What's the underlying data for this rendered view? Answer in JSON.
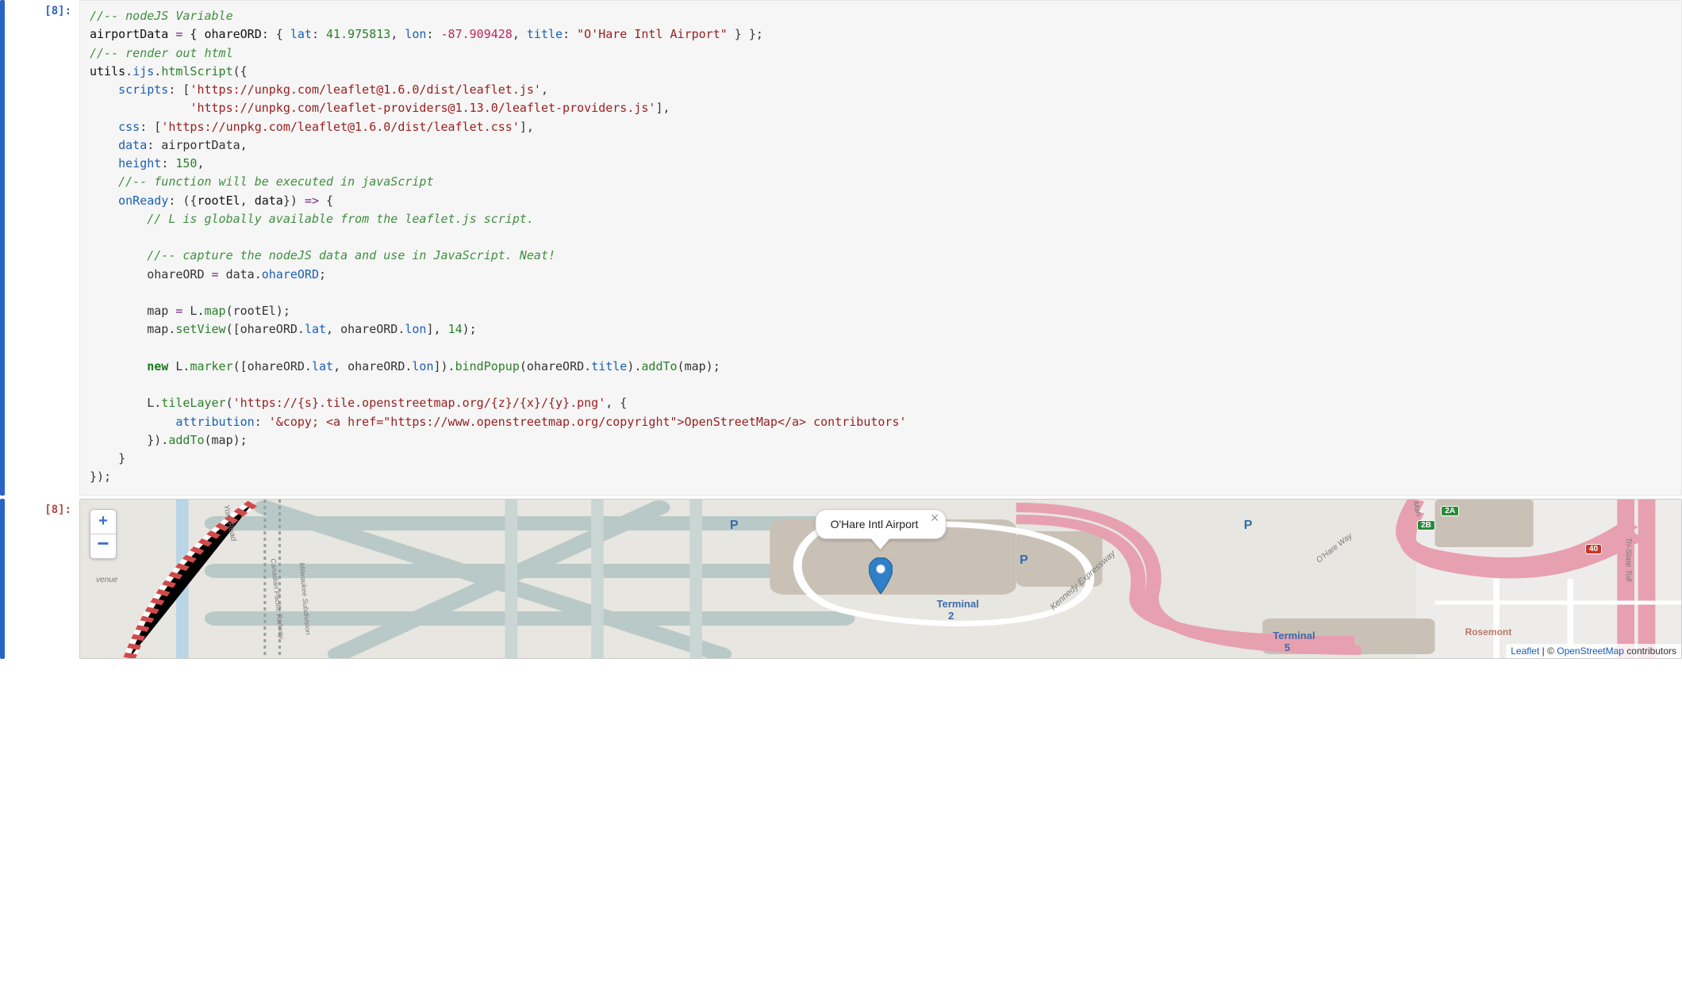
{
  "cells": {
    "code": {
      "prompt": "[8]:",
      "lines": [
        [
          {
            "cls": "c-cmt",
            "t": "//-- nodeJS Variable"
          }
        ],
        [
          {
            "cls": "c-ident",
            "t": "airportData "
          },
          {
            "cls": "c-op",
            "t": "="
          },
          {
            "cls": "c-ident",
            "t": " { ohareORD"
          },
          {
            "cls": "c-punct",
            "t": ": { "
          },
          {
            "cls": "c-prop",
            "t": "lat"
          },
          {
            "cls": "c-punct",
            "t": ": "
          },
          {
            "cls": "c-num",
            "t": "41.975813"
          },
          {
            "cls": "c-punct",
            "t": ", "
          },
          {
            "cls": "c-prop",
            "t": "lon"
          },
          {
            "cls": "c-punct",
            "t": ": "
          },
          {
            "cls": "c-neg",
            "t": "-87.909428"
          },
          {
            "cls": "c-punct",
            "t": ", "
          },
          {
            "cls": "c-prop",
            "t": "title"
          },
          {
            "cls": "c-punct",
            "t": ": "
          },
          {
            "cls": "c-str",
            "t": "\"O'Hare Intl Airport\""
          },
          {
            "cls": "c-punct",
            "t": " } };"
          }
        ],
        [
          {
            "cls": "c-cmt",
            "t": "//-- render out html"
          }
        ],
        [
          {
            "cls": "c-ident",
            "t": "utils"
          },
          {
            "cls": "c-punct",
            "t": "."
          },
          {
            "cls": "c-member",
            "t": "ijs"
          },
          {
            "cls": "c-punct",
            "t": "."
          },
          {
            "cls": "c-call",
            "t": "htmlScript"
          },
          {
            "cls": "c-punct",
            "t": "({"
          }
        ],
        [
          {
            "cls": "c-punct",
            "t": "    "
          },
          {
            "cls": "c-prop",
            "t": "scripts"
          },
          {
            "cls": "c-punct",
            "t": ": ["
          },
          {
            "cls": "c-str",
            "t": "'https://unpkg.com/leaflet@1.6.0/dist/leaflet.js'"
          },
          {
            "cls": "c-punct",
            "t": ","
          }
        ],
        [
          {
            "cls": "c-punct",
            "t": "              "
          },
          {
            "cls": "c-str",
            "t": "'https://unpkg.com/leaflet-providers@1.13.0/leaflet-providers.js'"
          },
          {
            "cls": "c-punct",
            "t": "],"
          }
        ],
        [
          {
            "cls": "c-punct",
            "t": "    "
          },
          {
            "cls": "c-prop",
            "t": "css"
          },
          {
            "cls": "c-punct",
            "t": ": ["
          },
          {
            "cls": "c-str",
            "t": "'https://unpkg.com/leaflet@1.6.0/dist/leaflet.css'"
          },
          {
            "cls": "c-punct",
            "t": "],"
          }
        ],
        [
          {
            "cls": "c-punct",
            "t": "    "
          },
          {
            "cls": "c-prop",
            "t": "data"
          },
          {
            "cls": "c-punct",
            "t": ": airportData,"
          }
        ],
        [
          {
            "cls": "c-punct",
            "t": "    "
          },
          {
            "cls": "c-prop",
            "t": "height"
          },
          {
            "cls": "c-punct",
            "t": ": "
          },
          {
            "cls": "c-num",
            "t": "150"
          },
          {
            "cls": "c-punct",
            "t": ","
          }
        ],
        [
          {
            "cls": "c-punct",
            "t": "    "
          },
          {
            "cls": "c-cmt",
            "t": "//-- function will be executed in javaScript"
          }
        ],
        [
          {
            "cls": "c-punct",
            "t": "    "
          },
          {
            "cls": "c-prop",
            "t": "onReady"
          },
          {
            "cls": "c-punct",
            "t": ": ({"
          },
          {
            "cls": "c-ident",
            "t": "rootEl"
          },
          {
            "cls": "c-punct",
            "t": ", "
          },
          {
            "cls": "c-ident",
            "t": "data"
          },
          {
            "cls": "c-punct",
            "t": "}) "
          },
          {
            "cls": "c-op",
            "t": "=>"
          },
          {
            "cls": "c-punct",
            "t": " {"
          }
        ],
        [
          {
            "cls": "c-punct",
            "t": "        "
          },
          {
            "cls": "c-cmt",
            "t": "// L is globally available from the leaflet.js script."
          }
        ],
        [
          {
            "cls": "c-punct",
            "t": ""
          }
        ],
        [
          {
            "cls": "c-punct",
            "t": "        "
          },
          {
            "cls": "c-cmt",
            "t": "//-- capture the nodeJS data and use in JavaScript. Neat!"
          }
        ],
        [
          {
            "cls": "c-punct",
            "t": "        ohareORD "
          },
          {
            "cls": "c-op",
            "t": "="
          },
          {
            "cls": "c-punct",
            "t": " data."
          },
          {
            "cls": "c-member",
            "t": "ohareORD"
          },
          {
            "cls": "c-punct",
            "t": ";"
          }
        ],
        [
          {
            "cls": "c-punct",
            "t": ""
          }
        ],
        [
          {
            "cls": "c-punct",
            "t": "        map "
          },
          {
            "cls": "c-op",
            "t": "="
          },
          {
            "cls": "c-punct",
            "t": " L."
          },
          {
            "cls": "c-call",
            "t": "map"
          },
          {
            "cls": "c-punct",
            "t": "(rootEl);"
          }
        ],
        [
          {
            "cls": "c-punct",
            "t": "        map."
          },
          {
            "cls": "c-call",
            "t": "setView"
          },
          {
            "cls": "c-punct",
            "t": "([ohareORD."
          },
          {
            "cls": "c-member",
            "t": "lat"
          },
          {
            "cls": "c-punct",
            "t": ", ohareORD."
          },
          {
            "cls": "c-member",
            "t": "lon"
          },
          {
            "cls": "c-punct",
            "t": "], "
          },
          {
            "cls": "c-num",
            "t": "14"
          },
          {
            "cls": "c-punct",
            "t": ");"
          }
        ],
        [
          {
            "cls": "c-punct",
            "t": ""
          }
        ],
        [
          {
            "cls": "c-punct",
            "t": "        "
          },
          {
            "cls": "c-kw",
            "t": "new"
          },
          {
            "cls": "c-punct",
            "t": " L."
          },
          {
            "cls": "c-call",
            "t": "marker"
          },
          {
            "cls": "c-punct",
            "t": "([ohareORD."
          },
          {
            "cls": "c-member",
            "t": "lat"
          },
          {
            "cls": "c-punct",
            "t": ", ohareORD."
          },
          {
            "cls": "c-member",
            "t": "lon"
          },
          {
            "cls": "c-punct",
            "t": "])."
          },
          {
            "cls": "c-call",
            "t": "bindPopup"
          },
          {
            "cls": "c-punct",
            "t": "(ohareORD."
          },
          {
            "cls": "c-member",
            "t": "title"
          },
          {
            "cls": "c-punct",
            "t": ")."
          },
          {
            "cls": "c-call",
            "t": "addTo"
          },
          {
            "cls": "c-punct",
            "t": "(map);"
          }
        ],
        [
          {
            "cls": "c-punct",
            "t": ""
          }
        ],
        [
          {
            "cls": "c-punct",
            "t": "        L."
          },
          {
            "cls": "c-call",
            "t": "tileLayer"
          },
          {
            "cls": "c-punct",
            "t": "("
          },
          {
            "cls": "c-str",
            "t": "'https://{s}.tile.openstreetmap.org/{z}/{x}/{y}.png'"
          },
          {
            "cls": "c-punct",
            "t": ", {"
          }
        ],
        [
          {
            "cls": "c-punct",
            "t": "            "
          },
          {
            "cls": "c-prop",
            "t": "attribution"
          },
          {
            "cls": "c-punct",
            "t": ": "
          },
          {
            "cls": "c-str",
            "t": "'&copy; <a href=\"https://www.openstreetmap.org/copyright\">OpenStreetMap</a> contributors'"
          }
        ],
        [
          {
            "cls": "c-punct",
            "t": "        })."
          },
          {
            "cls": "c-call",
            "t": "addTo"
          },
          {
            "cls": "c-punct",
            "t": "(map);"
          }
        ],
        [
          {
            "cls": "c-punct",
            "t": "    }"
          }
        ],
        [
          {
            "cls": "c-punct",
            "t": "});"
          }
        ]
      ]
    },
    "output": {
      "prompt": "[8]:",
      "popup_text": "O'Hare Intl Airport",
      "zoom_in": "+",
      "zoom_out": "−",
      "attribution": {
        "leaflet": "Leaflet",
        "sep": " | © ",
        "osm": "OpenStreetMap",
        "tail": " contributors"
      },
      "labels": {
        "terminal2a": "Terminal",
        "terminal2b": "2",
        "terminal5a": "Terminal",
        "terminal5b": "5",
        "ohare_way": "O'Hare Way",
        "york_road": "York Road",
        "kennedy": "Kennedy Expressway",
        "venue": "venue",
        "rosemont": "Rosemont",
        "mannheim": "Man",
        "tri_state": "Tri-State Toll",
        "cpr": "Canadian Pacific Railway",
        "mws": "Milwaukee Subdivision",
        "sign_2a": "2A",
        "sign_2b": "2B",
        "sign_40": "40",
        "parking": "P"
      }
    }
  }
}
